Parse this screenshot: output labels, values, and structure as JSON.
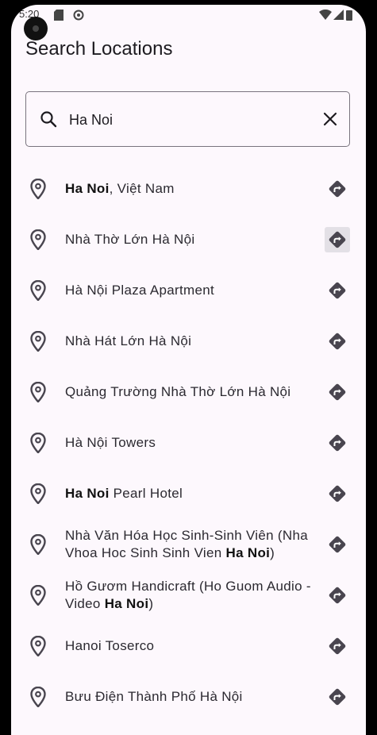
{
  "status_bar": {
    "time": "5:20"
  },
  "page_title": "Search Locations",
  "search": {
    "value": "Ha Noi",
    "placeholder": ""
  },
  "results": [
    {
      "before": "",
      "bold": "Ha Noi",
      "after": ", Việt Nam"
    },
    {
      "before": "Nhà Thờ Lớn Hà Nội",
      "bold": "",
      "after": ""
    },
    {
      "before": "Hà Nội Plaza Apartment",
      "bold": "",
      "after": ""
    },
    {
      "before": "Nhà Hát Lớn Hà Nội",
      "bold": "",
      "after": ""
    },
    {
      "before": "Quảng Trường Nhà Thờ Lớn Hà Nội",
      "bold": "",
      "after": ""
    },
    {
      "before": "Hà Nội Towers",
      "bold": "",
      "after": ""
    },
    {
      "before": "",
      "bold": "Ha Noi",
      "after": " Pearl Hotel"
    },
    {
      "before": "Nhà Văn Hóa Học Sinh-Sinh Viên (Nha Vhoa Hoc Sinh Sinh Vien ",
      "bold": "Ha Noi",
      "after": ")"
    },
    {
      "before": "Hồ Gươm Handicraft (Ho Guom Audio - Video ",
      "bold": "Ha Noi",
      "after": ")"
    },
    {
      "before": "Hanoi Toserco",
      "bold": "",
      "after": ""
    },
    {
      "before": "Bưu Điện Thành Phố Hà Nội",
      "bold": "",
      "after": ""
    }
  ],
  "colors": {
    "background": "#fdf8fd",
    "icon": "#49454f",
    "outline": "#79747e"
  },
  "icons": {
    "result": "location-pin-icon",
    "action": "directions-icon"
  }
}
